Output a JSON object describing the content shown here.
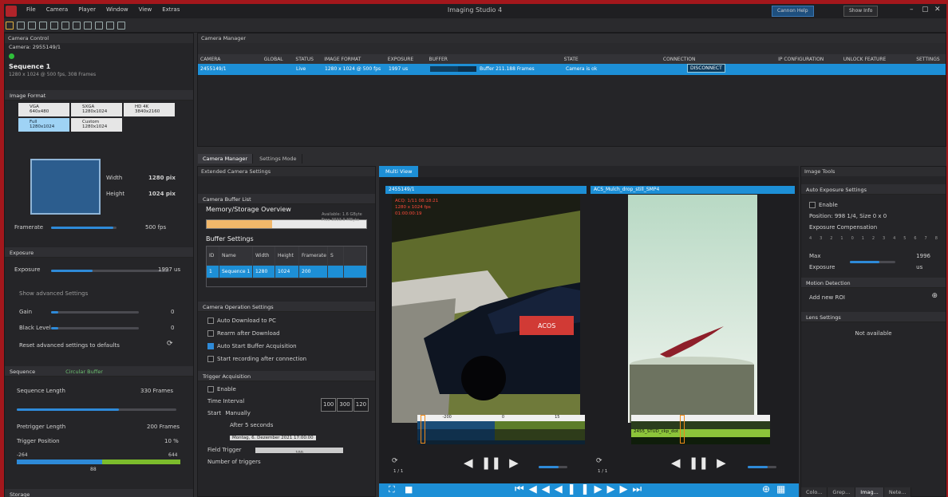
{
  "app": {
    "title": "Imaging Studio 4",
    "menu": [
      "File",
      "Camera",
      "Player",
      "Window",
      "View",
      "Extras"
    ],
    "help_label": "Cannon Help",
    "about_label": "Show Info"
  },
  "camera_control": {
    "panel_title": "Camera Control",
    "camera_label": "Camera: 2955149/1",
    "sequence_title": "Sequence 1",
    "sequence_info": "1280 x 1024 @ 500 fps, 308 Frames",
    "image_format_title": "Image Format",
    "formats": [
      {
        "name": "VGA",
        "sub": "640x480"
      },
      {
        "name": "SXGA",
        "sub": "1280x1024"
      },
      {
        "name": "HD 4K",
        "sub": "3840x2160"
      },
      {
        "name": "Full",
        "sub": "1280x1024"
      },
      {
        "name": "Custom",
        "sub": "1280x1024"
      }
    ],
    "width_label": "Width",
    "width_value": "1280 pix",
    "height_label": "Height",
    "height_value": "1024 pix",
    "framerate_label": "Framerate",
    "framerate_value": "500 fps",
    "exposure_title": "Exposure",
    "exposure_label": "Exposure",
    "exposure_value": "1997 us",
    "advanced_label": "Show advanced Settings",
    "gain_label": "Gain",
    "gain_value": "0",
    "black_label": "Black Level",
    "black_value": "0",
    "reset_label": "Reset advanced settings to defaults",
    "sequence_section": "Sequence",
    "buffer_mode": "Circular Buffer",
    "seq_length_label": "Sequence Length",
    "seq_length_value": "330 Frames",
    "pretrigger_label": "Pretrigger Length",
    "pretrigger_value": "200 Frames",
    "trigger_pos_label": "Trigger Position",
    "trigger_pos_value": "10 %",
    "range_left": "-264",
    "range_right": "644",
    "range_mid": "88",
    "storage_title": "Storage"
  },
  "camera_manager": {
    "panel_title": "Camera Manager",
    "columns": [
      "CAMERA",
      "GLOBAL",
      "STATUS",
      "IMAGE FORMAT",
      "EXPOSURE",
      "BUFFER",
      "STATE",
      "CONNECTION",
      "IP CONFIGURATION",
      "UNLOCK FEATURE",
      "SETTINGS"
    ],
    "row": {
      "camera": "2455149/1",
      "status": "Live",
      "format": "1280 x 1024 @ 500 fps",
      "exposure": "1997 us",
      "buffer": "Buffer 211.188 Frames",
      "state": "Camera is ok",
      "connection": "DISCONNECT"
    },
    "tabs": [
      "Camera Manager",
      "Settings Mode"
    ]
  },
  "extended": {
    "panel_title": "Extended Camera Settings",
    "buffer_title": "Camera Buffer List",
    "mem_title": "Memory/Storage Overview",
    "mem_used": "Available: 1.6 GByte",
    "mem_free": "Free 3693.9 MByte",
    "buffer_settings": "Buffer Settings",
    "cols": [
      "ID",
      "Name",
      "Width",
      "Height",
      "Framerate",
      "S"
    ],
    "row": [
      "1",
      "Sequence 1",
      "1280",
      "1024",
      "200",
      ""
    ],
    "op_title": "Camera Operation Settings",
    "op_items": [
      {
        "label": "Auto Download to PC",
        "on": false
      },
      {
        "label": "Rearm after Download",
        "on": false
      },
      {
        "label": "Auto Start Buffer Acquisition",
        "on": true
      },
      {
        "label": "Start recording after connection",
        "on": false
      }
    ],
    "trigger_title": "Trigger Acquisition",
    "trigger_item": "Enable",
    "time_interval": "Time Interval",
    "ti_values": [
      "100",
      "300",
      "120"
    ],
    "start_label": "Start",
    "manually": "Manually",
    "after_label": "After",
    "after_value": "5 seconds",
    "date_value": "Montag, 6. Dezember 2021 17:00:00",
    "field_label": "Field Trigger",
    "field_value": "100",
    "num_triggers": "Number of triggers"
  },
  "viewer": {
    "tab": "Multi View",
    "left_title": "2455149/1",
    "right_title": "ACS_Mulch_drop_still_SMP4",
    "overlay_lines": [
      "ACQ: 1/11 08:18:21",
      "1280 x 1024 fps",
      "01:00:00:19"
    ],
    "label_brand": "ACOS",
    "left_t1": "-200",
    "left_t2": "0",
    "left_t3": "15",
    "right_clip": "2455_STUD_ckp_dot",
    "frame_counter_l": "1 / 1",
    "frame_counter_r": "1 / 1"
  },
  "image_tools": {
    "panel_title": "Image Tools",
    "auto_exposure": "Auto Exposure Settings",
    "enable": "Enable",
    "position": "Position: 998 1/4, Size 0 x 0",
    "comp_label": "Exposure Compensation",
    "comp_ticks": [
      "4",
      "3",
      "2",
      "1",
      "0",
      "1",
      "2",
      "3",
      "4",
      "5",
      "6",
      "7",
      "8"
    ],
    "max_exp_label": "Max Exposure",
    "max_exp_value": "1996 us",
    "motion": "Motion Detection",
    "add_roi": "Add new ROI",
    "lens": "Lens Settings",
    "not_available": "Not available",
    "bottom_tabs": [
      "Colo...",
      "Grep...",
      "Imag...",
      "Nete..."
    ]
  }
}
